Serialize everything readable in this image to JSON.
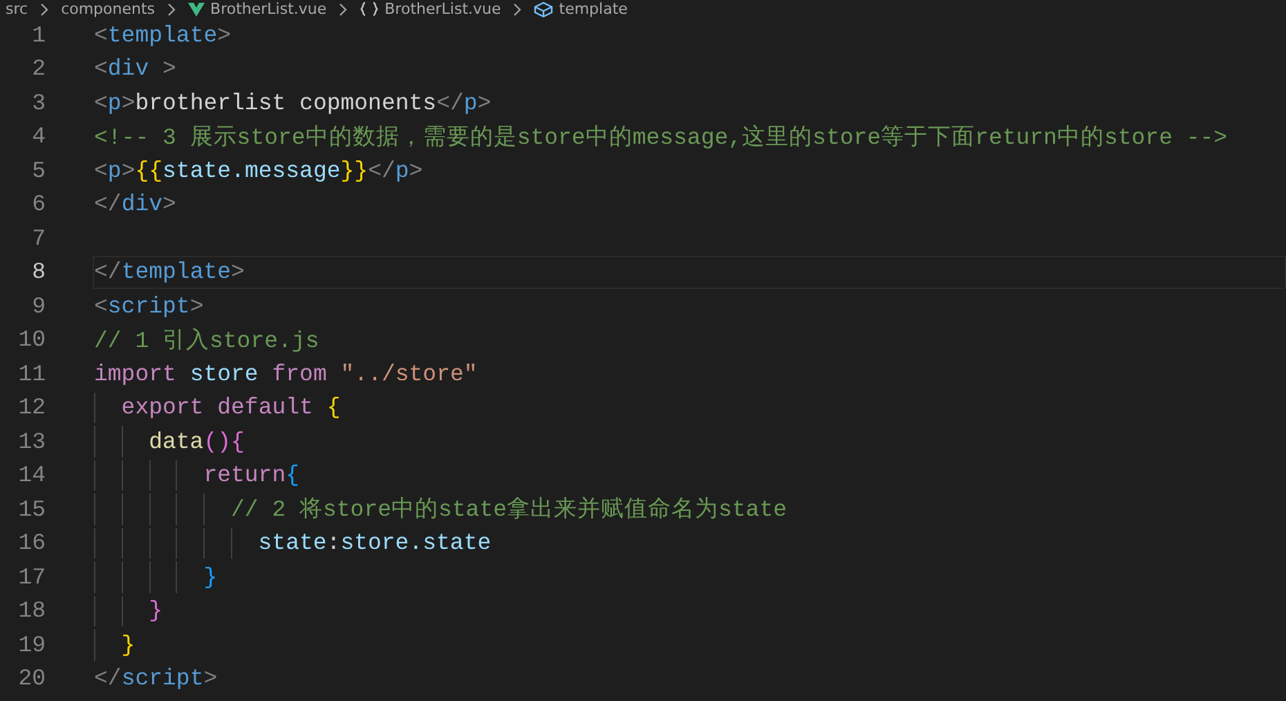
{
  "breadcrumb": [
    {
      "kind": "folder",
      "label": "src"
    },
    {
      "kind": "folder",
      "label": "components"
    },
    {
      "kind": "vue-file",
      "label": "BrotherList.vue"
    },
    {
      "kind": "module",
      "label": "BrotherList.vue"
    },
    {
      "kind": "element",
      "label": "template"
    }
  ],
  "lines": [
    {
      "number": "1",
      "active": false,
      "tokens": [
        {
          "kind": "bracket",
          "text": "<"
        },
        {
          "kind": "tag",
          "text": "template"
        },
        {
          "kind": "bracket",
          "text": ">"
        }
      ]
    },
    {
      "number": "2",
      "active": false,
      "tokens": [
        {
          "kind": "bracket",
          "text": "<"
        },
        {
          "kind": "tag",
          "text": "div"
        },
        {
          "kind": "bracket",
          "text": " >"
        }
      ]
    },
    {
      "number": "3",
      "active": false,
      "tokens": [
        {
          "kind": "bracket",
          "text": "<"
        },
        {
          "kind": "tag",
          "text": "p"
        },
        {
          "kind": "bracket",
          "text": ">"
        },
        {
          "kind": "plain",
          "text": "brotherlist copmonents"
        },
        {
          "kind": "bracket",
          "text": "</"
        },
        {
          "kind": "tag",
          "text": "p"
        },
        {
          "kind": "bracket",
          "text": ">"
        }
      ]
    },
    {
      "number": "4",
      "active": false,
      "tokens": [
        {
          "kind": "comment",
          "text": "<!-- 3 展示store中的数据，需要的是store中的message,这里的store等于下面return中的store -->"
        }
      ]
    },
    {
      "number": "5",
      "active": false,
      "tokens": [
        {
          "kind": "bracket",
          "text": "<"
        },
        {
          "kind": "tag",
          "text": "p"
        },
        {
          "kind": "bracket",
          "text": ">"
        },
        {
          "kind": "brace1",
          "text": "{{"
        },
        {
          "kind": "variable",
          "text": "state.message"
        },
        {
          "kind": "brace1",
          "text": "}}"
        },
        {
          "kind": "bracket",
          "text": "</"
        },
        {
          "kind": "tag",
          "text": "p"
        },
        {
          "kind": "bracket",
          "text": ">"
        }
      ]
    },
    {
      "number": "6",
      "active": false,
      "tokens": [
        {
          "kind": "bracket",
          "text": "</"
        },
        {
          "kind": "tag",
          "text": "div"
        },
        {
          "kind": "bracket",
          "text": ">"
        }
      ]
    },
    {
      "number": "7",
      "active": false
    },
    {
      "number": "8",
      "active": true,
      "tokens": [
        {
          "kind": "bracket",
          "text": "</"
        },
        {
          "kind": "tag",
          "text": "template"
        },
        {
          "kind": "bracket",
          "text": ">"
        }
      ]
    },
    {
      "number": "9",
      "active": false,
      "tokens": [
        {
          "kind": "bracket",
          "text": "<"
        },
        {
          "kind": "tag",
          "text": "script"
        },
        {
          "kind": "bracket",
          "text": ">"
        }
      ]
    },
    {
      "number": "10",
      "active": false,
      "tokens": [
        {
          "kind": "comment",
          "text": "// 1 引入store.js"
        }
      ]
    },
    {
      "number": "11",
      "active": false,
      "tokens": [
        {
          "kind": "keyword",
          "text": "import"
        },
        {
          "kind": "variable",
          "text": " store"
        },
        {
          "kind": "keyword",
          "text": " from"
        },
        {
          "kind": "string",
          "text": " \"../store\""
        }
      ]
    },
    {
      "number": "12",
      "active": false,
      "tokens": [
        {
          "kind": "keyword",
          "text": "  export default"
        },
        {
          "kind": "brace1",
          "text": " {"
        }
      ]
    },
    {
      "number": "13",
      "active": false,
      "tokens": [
        {
          "kind": "function",
          "text": "    data"
        },
        {
          "kind": "brace2",
          "text": "(){"
        }
      ]
    },
    {
      "number": "14",
      "active": false,
      "tokens": [
        {
          "kind": "keyword",
          "text": "        return"
        },
        {
          "kind": "brace3",
          "text": "{"
        }
      ]
    },
    {
      "number": "15",
      "active": false,
      "tokens": [
        {
          "kind": "comment",
          "text": "          // 2 将store中的state拿出来并赋值命名为state"
        }
      ]
    },
    {
      "number": "16",
      "active": false,
      "tokens": [
        {
          "kind": "variable",
          "text": "            state"
        },
        {
          "kind": "plain",
          "text": ":"
        },
        {
          "kind": "variable",
          "text": "store.state"
        }
      ]
    },
    {
      "number": "17",
      "active": false,
      "tokens": [
        {
          "kind": "brace3",
          "text": "        }"
        }
      ]
    },
    {
      "number": "18",
      "active": false,
      "tokens": [
        {
          "kind": "brace2",
          "text": "    }"
        }
      ]
    },
    {
      "number": "19",
      "active": false,
      "tokens": [
        {
          "kind": "brace1",
          "text": "  }"
        }
      ]
    },
    {
      "number": "20",
      "active": false,
      "tokens": [
        {
          "kind": "bracket",
          "text": "</"
        },
        {
          "kind": "tag",
          "text": "script"
        },
        {
          "kind": "bracket",
          "text": ">"
        }
      ]
    }
  ]
}
